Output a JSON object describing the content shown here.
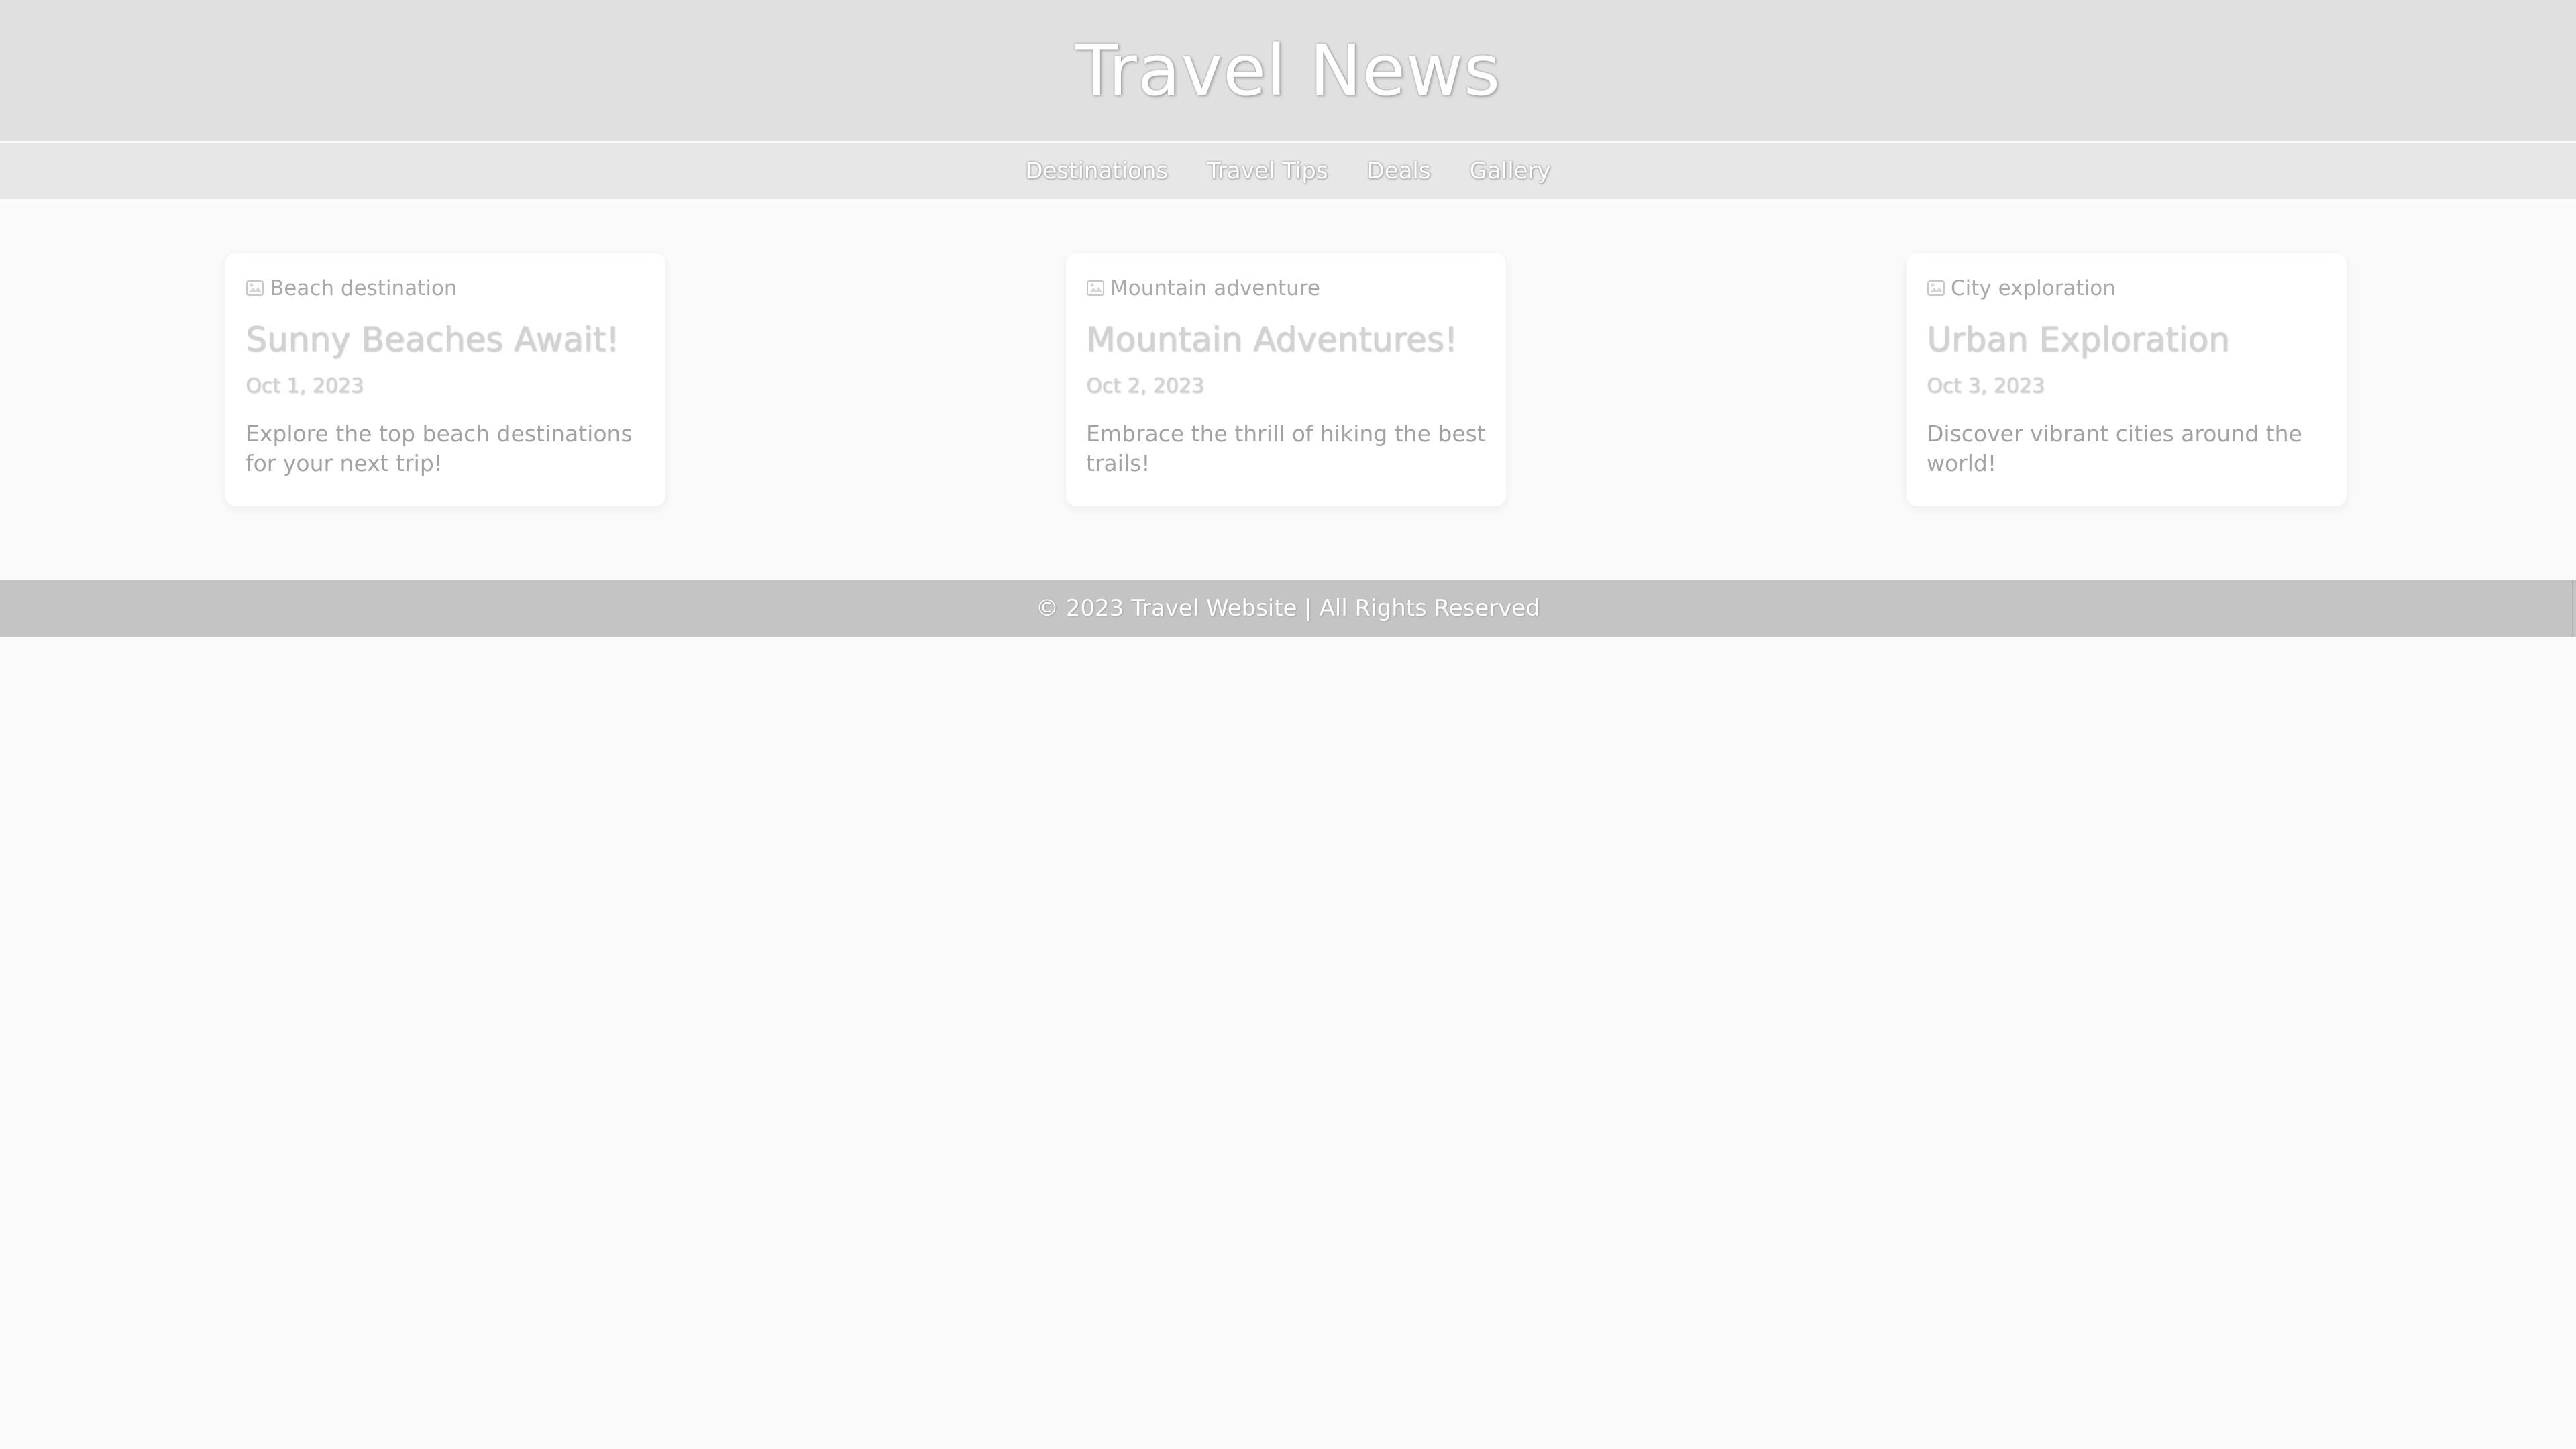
{
  "header": {
    "title": "Travel News"
  },
  "nav": {
    "items": [
      {
        "label": "Destinations"
      },
      {
        "label": "Travel Tips"
      },
      {
        "label": "Deals"
      },
      {
        "label": "Gallery"
      }
    ]
  },
  "articles": [
    {
      "image_alt": "Beach destination",
      "title": "Sunny Beaches Await!",
      "date": "Oct 1, 2023",
      "excerpt": "Explore the top beach destinations for your next trip!"
    },
    {
      "image_alt": "Mountain adventure",
      "title": "Mountain Adventures!",
      "date": "Oct 2, 2023",
      "excerpt": "Embrace the thrill of hiking the best trails!"
    },
    {
      "image_alt": "City exploration",
      "title": "Urban Exploration",
      "date": "Oct 3, 2023",
      "excerpt": "Discover vibrant cities around the world!"
    }
  ],
  "footer": {
    "text": "© 2023 Travel Website | All Rights Reserved"
  },
  "icons": {
    "broken_image": "broken-image-icon"
  },
  "colors": {
    "header_bg": "#e0e0e0",
    "nav_bg": "#e7e7e7",
    "page_bg": "#fafafa",
    "footer_bg": "#c4c4c4",
    "card_bg": "#ffffff"
  }
}
